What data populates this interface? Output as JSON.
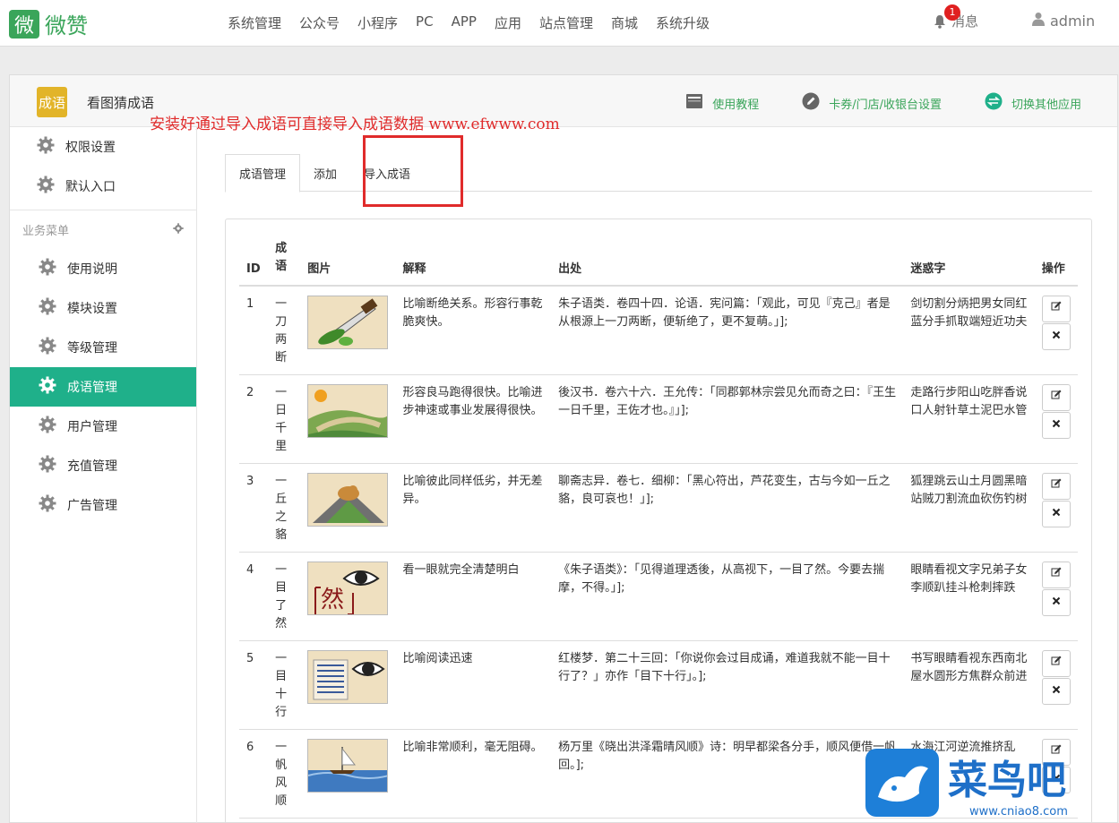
{
  "topbar": {
    "logo_mark": "微",
    "logo_text": "微赞",
    "nav": [
      "系统管理",
      "公众号",
      "小程序",
      "PC",
      "APP",
      "应用",
      "站点管理",
      "商城",
      "系统升级"
    ],
    "msg_label": "消息",
    "msg_count": "1",
    "user_name": "admin"
  },
  "panel": {
    "app_icon_text": "成语",
    "app_name": "看图猜成语",
    "notice": "安装好通过导入成语可直接导入成语数据 www.efwww.com",
    "links": [
      "使用教程",
      "卡券/门店/收银台设置",
      "切换其他应用"
    ]
  },
  "sidebar": {
    "top_items": [
      "权限设置",
      "默认入口"
    ],
    "group_label": "业务菜单",
    "items": [
      "使用说明",
      "模块设置",
      "等级管理",
      "成语管理",
      "用户管理",
      "充值管理",
      "广告管理"
    ],
    "active_index": 3
  },
  "tabs": [
    "成语管理",
    "添加",
    "导入成语"
  ],
  "table": {
    "headers": [
      "ID",
      "成语",
      "图片",
      "解释",
      "出处",
      "迷惑字",
      "操作"
    ],
    "rows": [
      {
        "id": "1",
        "idiom": "一刀两断",
        "image": "knife-cucumber",
        "explain": "比喻断绝关系。形容行事乾脆爽快。",
        "source": "朱子语类．卷四十四．论语．宪问篇：「观此，可见『克己』者是从根源上一刀两断，便斩绝了，更不复萌。」];",
        "distract": "剑切割分炳把男女同红蓝分手抓取端短近功夫"
      },
      {
        "id": "2",
        "idiom": "一日千里",
        "image": "sun-landscape",
        "explain": "形容良马跑得很快。比喻进步神速或事业发展得很快。",
        "source": "後汉书．卷六十六．王允传：「同郡郭林宗尝见允而奇之曰：『王生一日千里，王佐才也。』」];",
        "distract": "走路行步阳山吃胖香说口人射针草土泥巴水管"
      },
      {
        "id": "3",
        "idiom": "一丘之貉",
        "image": "animal-hill",
        "explain": "比喻彼此同样低劣，并无差异。",
        "source": "聊斋志异．卷七．细柳：「黑心符出，芦花变生，古与今如一丘之貉，良可哀也！」];",
        "distract": "狐狸跳云山土月圆黑暗站贼刀割流血砍伤钓树"
      },
      {
        "id": "4",
        "idiom": "一目了然",
        "image": "eye-ran",
        "explain": "看一眼就完全清楚明白",
        "source": "《朱子语类》：「见得道理透後，从高视下，一目了然。今要去揣摩，不得。」];",
        "distract": "眼睛看视文字兄弟子女李顺趴挂斗枪刺摔跌"
      },
      {
        "id": "5",
        "idiom": "一目十行",
        "image": "eye-text",
        "explain": "比喻阅读迅速",
        "source": "红楼梦．第二十三回：「你说你会过目成诵，难道我就不能一目十行了？」亦作「目下十行」。];",
        "distract": "书写眼睛看视东西南北屋水圆形方焦群众前进"
      },
      {
        "id": "6",
        "idiom": "一帆风顺",
        "image": "sailboat",
        "explain": "比喻非常顺利，毫无阻碍。",
        "source": "杨万里《晓出洪泽霜晴风顺》诗：明早都梁各分手，顺风便借一帆回。];",
        "distract": "水海江河逆流推挤乱"
      }
    ]
  },
  "watermark": {
    "title": "菜鸟吧",
    "url": "www.cniao8.com"
  },
  "colors": {
    "brand_green": "#3aa55a",
    "active_teal": "#1fb08a",
    "notice_red": "#e02b2b"
  }
}
